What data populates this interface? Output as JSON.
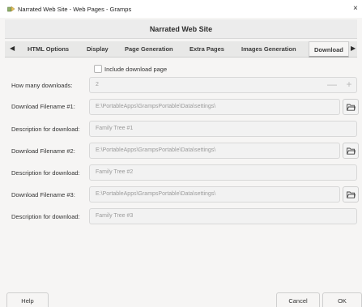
{
  "window": {
    "title": "Narrated Web Site - Web Pages - Gramps",
    "close_glyph": "×"
  },
  "header": {
    "title": "Narrated Web Site"
  },
  "tabs": {
    "prev_glyph": "◀",
    "next_glyph": "▶",
    "items": [
      {
        "label": "HTML Options"
      },
      {
        "label": "Display"
      },
      {
        "label": "Page Generation"
      },
      {
        "label": "Extra Pages"
      },
      {
        "label": "Images Generation"
      },
      {
        "label": "Download",
        "active": true
      }
    ]
  },
  "form": {
    "include_download": {
      "label": "Include download page",
      "checked": false
    },
    "how_many": {
      "label": "How many downloads:",
      "value": "2",
      "minus": "—",
      "plus": "+"
    },
    "downloads": [
      {
        "filename_label": "Download Filename #1:",
        "filename": "E:\\PortableApps\\GrampsPortable\\Data\\settings\\",
        "desc_label": "Description for download:",
        "desc": "Family Tree #1"
      },
      {
        "filename_label": "Download Filename #2:",
        "filename": "E:\\PortableApps\\GrampsPortable\\Data\\settings\\",
        "desc_label": "Description for download:",
        "desc": "Family Tree #2"
      },
      {
        "filename_label": "Download Filename #3:",
        "filename": "E:\\PortableApps\\GrampsPortable\\Data\\settings\\",
        "desc_label": "Description for download:",
        "desc": "Family Tree #3"
      }
    ]
  },
  "buttons": {
    "help": "Help",
    "cancel": "Cancel",
    "ok": "OK"
  },
  "icons": {
    "app": "gramps-app-icon",
    "folder": "folder-open-icon"
  },
  "colors": {
    "field_bg": "#f2f2f2",
    "active_tab_underline": "#a9a9a9",
    "placeholder_text": "#9b9b9b"
  }
}
